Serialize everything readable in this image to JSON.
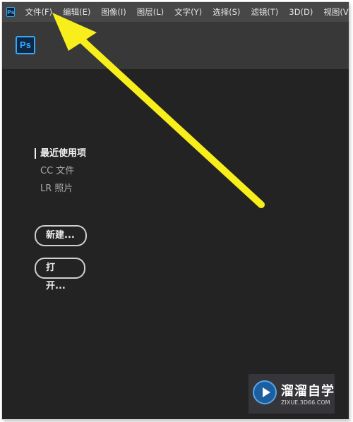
{
  "menubar": {
    "app_icon_text": "Ps",
    "items": [
      {
        "label": "文件(F)"
      },
      {
        "label": "编辑(E)"
      },
      {
        "label": "图像(I)"
      },
      {
        "label": "图层(L)"
      },
      {
        "label": "文字(Y)"
      },
      {
        "label": "选择(S)"
      },
      {
        "label": "滤镜(T)"
      },
      {
        "label": "3D(D)"
      },
      {
        "label": "视图(V)"
      }
    ]
  },
  "header": {
    "logo_text": "Ps"
  },
  "sidebar": {
    "items": [
      {
        "label": "最近使用项",
        "active": true
      },
      {
        "label": "CC 文件",
        "active": false
      },
      {
        "label": "LR 照片",
        "active": false
      }
    ]
  },
  "buttons": {
    "new_label": "新建...",
    "open_label": "打开..."
  },
  "watermark": {
    "title": "溜溜自学",
    "url": "ZIXUE.3D66.COM"
  },
  "annotation": {
    "arrow_color": "#f7ee1b",
    "arrow_target": "文件(F)"
  }
}
